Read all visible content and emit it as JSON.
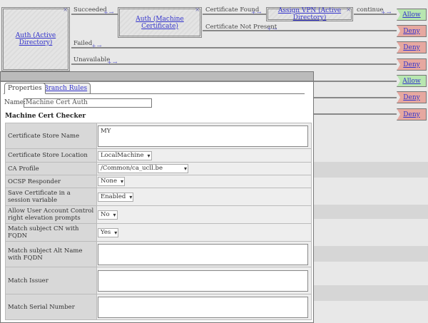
{
  "flow": {
    "node_ad": "Auth (Active Directory)",
    "node_mc": "Auth (Machine Certificate)",
    "node_vpn": "Assign VPN (Active Directory)",
    "branches": {
      "succeeded": "Succeeded",
      "failed": "Failed",
      "unavailable": "Unavailable",
      "cert_found": "Certificate Found",
      "cert_not_present": "Certificate Not Present",
      "continue": "continue"
    },
    "terminals": [
      "Allow",
      "Deny",
      "Deny",
      "Deny",
      "Allow",
      "Deny",
      "Deny"
    ]
  },
  "panel": {
    "tabs": [
      "Properties",
      "Branch Rules"
    ],
    "name_label": "Name:",
    "name_value": "Machine Cert Auth",
    "heading": "Machine Cert Checker",
    "rows": [
      {
        "label": "Certificate Store Name",
        "value": "MY"
      },
      {
        "label": "Certificate Store Location",
        "value": "LocalMachine"
      },
      {
        "label": "CA Profile",
        "value": "/Common/ca_ucll.be"
      },
      {
        "label": "OCSP Responder",
        "value": "None"
      },
      {
        "label": "Save Certificate in a session variable",
        "value": "Enabled"
      },
      {
        "label": "Allow User Account Control right elevation prompts",
        "value": "No"
      },
      {
        "label": "Match subject CN with FQDN",
        "value": "Yes"
      },
      {
        "label": "Match subject Alt Name with FQDN",
        "value": ""
      },
      {
        "label": "Match Issuer",
        "value": ""
      },
      {
        "label": "Match Serial Number",
        "value": ""
      }
    ]
  }
}
